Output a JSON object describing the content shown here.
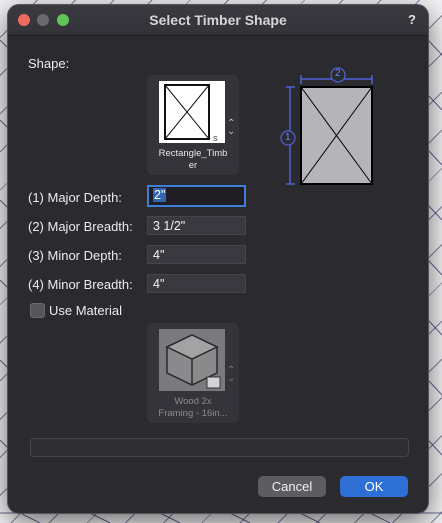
{
  "window": {
    "title": "Select Timber Shape",
    "help": "?"
  },
  "shape_label": "Shape:",
  "shape_tile": {
    "name": "Rectangle_Timber",
    "line1": "Rectangle_Timb",
    "line2": "er"
  },
  "diagram": {
    "label_breadth": "2",
    "label_depth": "1"
  },
  "fields": [
    {
      "label": "(1) Major Depth:",
      "value": "2\""
    },
    {
      "label": "(2) Major Breadth:",
      "value": "3 1/2\""
    },
    {
      "label": "(3) Minor Depth:",
      "value": "4\""
    },
    {
      "label": "(4) Minor Breadth:",
      "value": "4\""
    }
  ],
  "use_material": {
    "label": "Use Material",
    "checked": false
  },
  "material_tile": {
    "line1": "Wood 2x",
    "line2": "Framing - 16in..."
  },
  "buttons": {
    "cancel": "Cancel",
    "ok": "OK"
  },
  "colors": {
    "accent": "#2e6fd6",
    "dialog_bg": "#2b2a2f",
    "diagram_blue": "#4b63d6"
  }
}
